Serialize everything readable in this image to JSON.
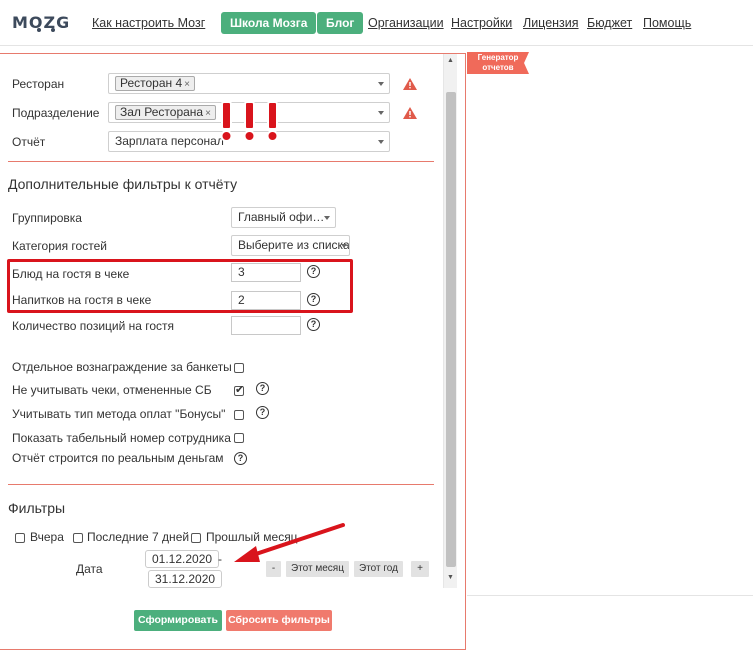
{
  "brand": {
    "logo_text": "MOZG"
  },
  "nav": {
    "links": [
      "Как настроить Мозг",
      "Организации",
      "Настройки",
      "Лицензия",
      "Бюджет",
      "Помощь"
    ],
    "buttons": [
      "Школа Мозга",
      "Блог"
    ]
  },
  "generator_tag": {
    "line1": "Генератор",
    "line2": "отчетов"
  },
  "form": {
    "restaurant": {
      "label": "Ресторан",
      "chip": "Ресторан 4",
      "chip_x": "×"
    },
    "division": {
      "label": "Подразделение",
      "chip": "Зал Ресторана",
      "chip_x": "×"
    },
    "report": {
      "label": "Отчёт",
      "value": "Зарплата персонал"
    }
  },
  "extra_filters": {
    "title": "Дополнительные фильтры к отчёту",
    "grouping": {
      "label": "Группировка",
      "value": "Главный офи…"
    },
    "guest_category": {
      "label": "Категория гостей",
      "value": "Выберите из списка"
    },
    "dishes": {
      "label": "Блюд на гостя в чеке",
      "value": "3"
    },
    "drinks": {
      "label": "Напитков на гостя в чеке",
      "value": "2"
    },
    "positions": {
      "label": "Количество позиций на гостя",
      "value": ""
    },
    "checkboxes": [
      {
        "label": "Отдельное вознаграждение за банкеты",
        "checked": false,
        "help": false
      },
      {
        "label": "Не учитывать чеки, отмененные СБ",
        "checked": true,
        "help": true
      },
      {
        "label": "Учитывать тип метода оплат \"Бонусы\"",
        "checked": false,
        "help": true
      },
      {
        "label": "Показать табельный номер сотрудника",
        "checked": false,
        "help": false
      },
      {
        "label": "Отчёт строится по реальным деньгам",
        "checked": null,
        "help": true
      }
    ],
    "help_glyph": "?"
  },
  "filters": {
    "title": "Фильтры",
    "quick": [
      "Вчера",
      "Последние 7 дней",
      "Прошлый месяц"
    ],
    "date_label": "Дата",
    "date_from": "01.12.2020",
    "date_to": "31.12.2020",
    "dash": "-",
    "minus": "-",
    "this_month": "Этот месяц",
    "this_year": "Этот год",
    "plus": "+"
  },
  "actions": {
    "submit": "Сформировать",
    "reset": "Сбросить фильтры"
  },
  "colors": {
    "accent_green": "#4caf7d",
    "accent_red": "#f07a6d",
    "highlight_red": "#d9141c"
  }
}
